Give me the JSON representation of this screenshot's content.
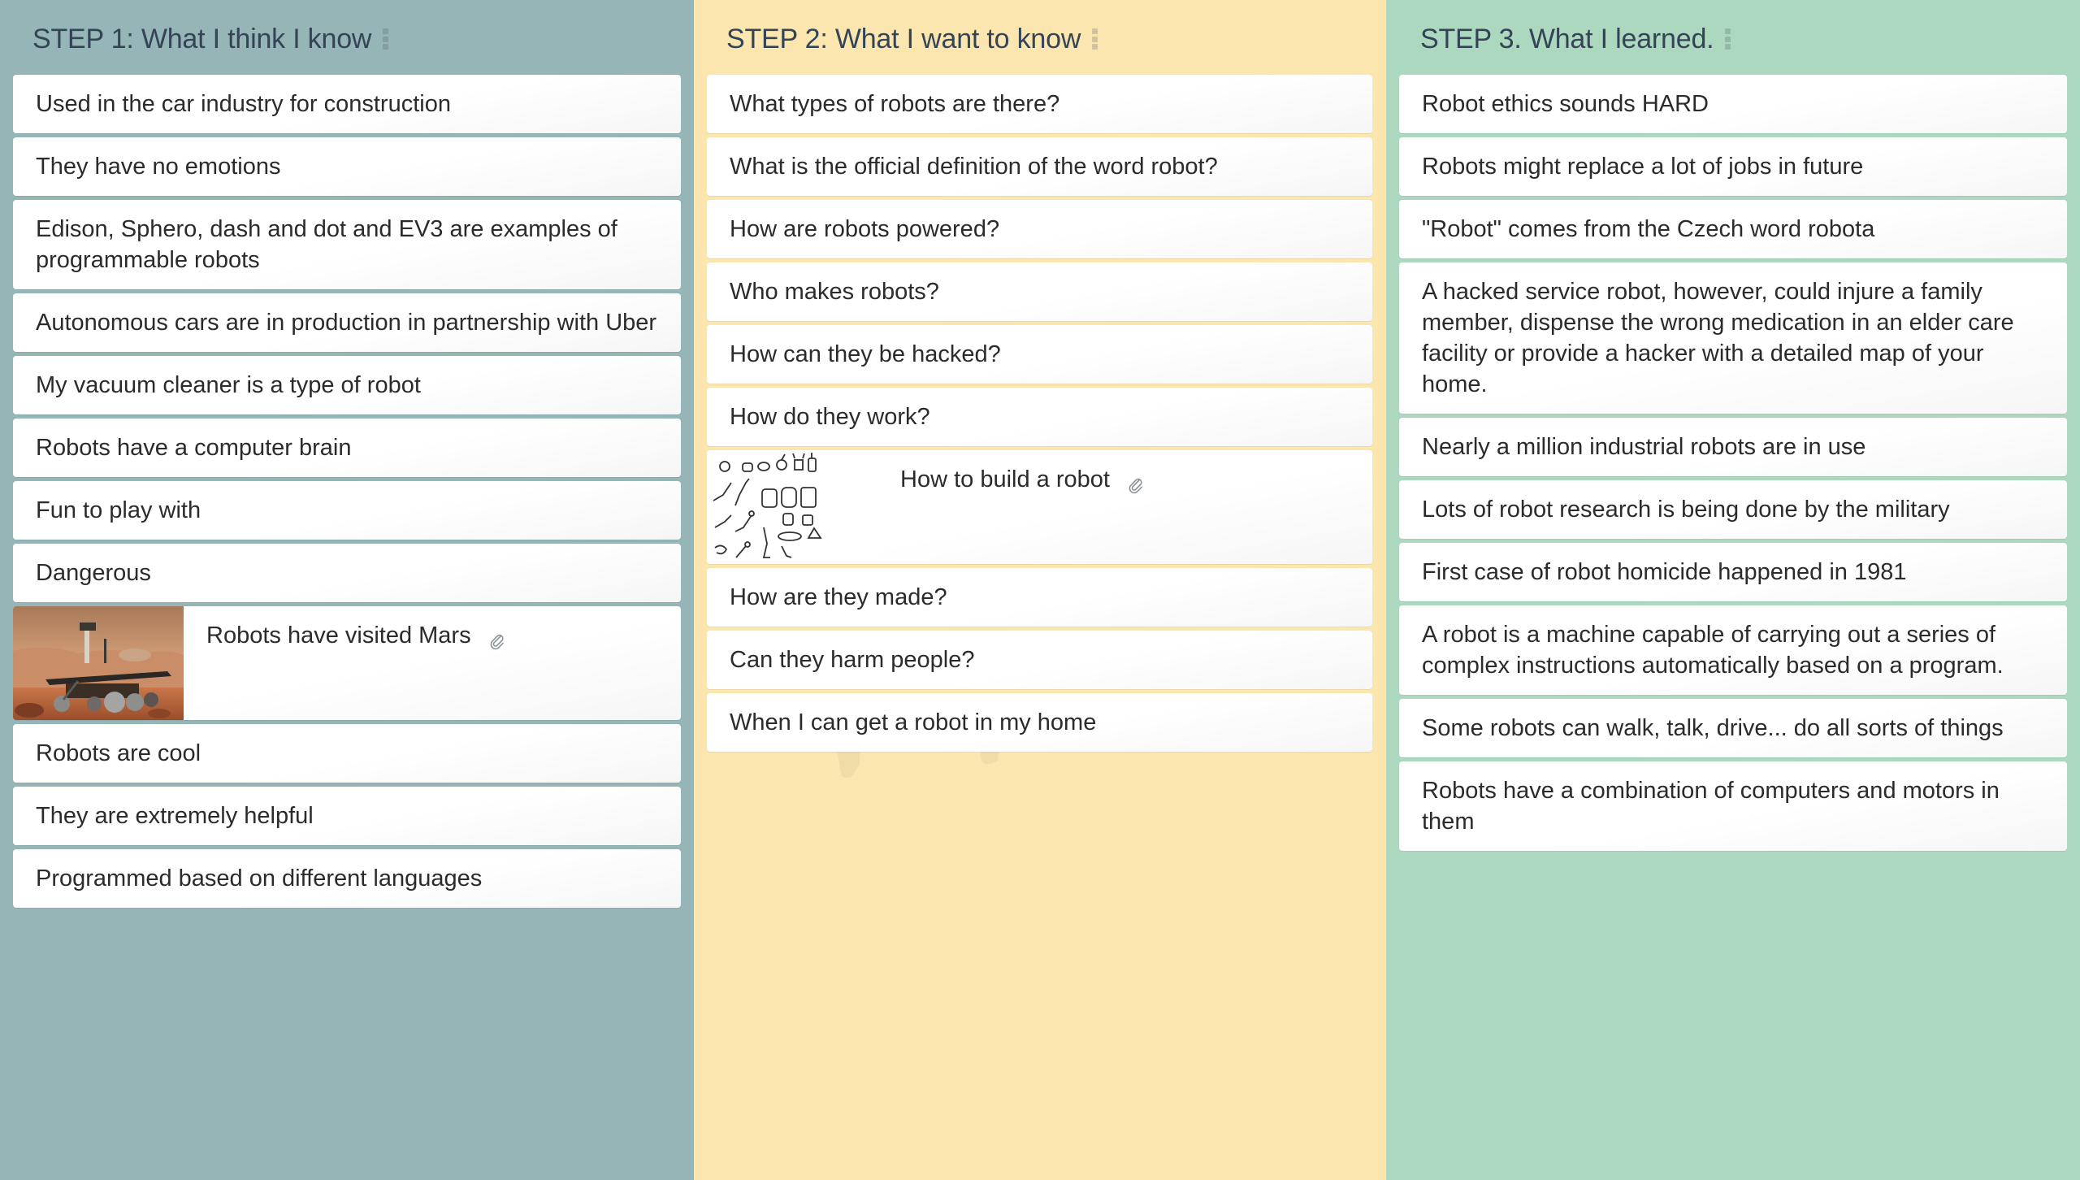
{
  "board": {
    "columns": [
      {
        "title": "STEP 1: What I think I know",
        "color": "#96b5b6",
        "cards": [
          {
            "text": "Used in the car industry for construction"
          },
          {
            "text": "They have no emotions"
          },
          {
            "text": "Edison, Sphero, dash and dot and EV3 are examples of programmable robots"
          },
          {
            "text": "Autonomous cars are in production in partnership with Uber"
          },
          {
            "text": "My vacuum cleaner is a type of robot"
          },
          {
            "text": "Robots have a computer brain"
          },
          {
            "text": "Fun to play with"
          },
          {
            "text": "Dangerous"
          },
          {
            "text": "Robots have visited Mars",
            "image": "mars-rover-photo",
            "attachment": true
          },
          {
            "text": "Robots are cool"
          },
          {
            "text": "They are extremely helpful"
          },
          {
            "text": "Programmed based on different languages"
          }
        ]
      },
      {
        "title": "STEP 2: What I want to know",
        "color": "#fbe6b0",
        "cards": [
          {
            "text": "What types of robots are there?"
          },
          {
            "text": "What is the official definition of the word robot?"
          },
          {
            "text": "How are robots powered?"
          },
          {
            "text": "Who makes robots?"
          },
          {
            "text": "How can they be hacked?"
          },
          {
            "text": "How do they work?"
          },
          {
            "text": "How to build a robot",
            "image": "robot-sketches",
            "attachment": true
          },
          {
            "text": "How are they made?"
          },
          {
            "text": "Can they harm people?"
          },
          {
            "text": "When I can get a robot in my home"
          }
        ]
      },
      {
        "title": "STEP 3. What I learned.",
        "color": "#acd8bf",
        "cards": [
          {
            "text": "Robot ethics sounds HARD"
          },
          {
            "text": "Robots might replace a lot of jobs in future"
          },
          {
            "text": "\"Robot\" comes from the Czech word robota"
          },
          {
            "text": "A hacked service robot, however, could injure a family member, dispense the wrong medication in an elder care facility or provide a hacker with a detailed map of your home."
          },
          {
            "text": "Nearly a million industrial robots are in use"
          },
          {
            "text": "Lots of robot research is being done by the military"
          },
          {
            "text": "First case of robot homicide happened in 1981"
          },
          {
            "text": "A robot is a  machine capable of carrying out a series of complex instructions automatically based on a program."
          },
          {
            "text": "Some robots can walk, talk, drive... do all sorts of things"
          },
          {
            "text": "Robots have a combination of computers and motors in them"
          }
        ]
      }
    ]
  },
  "icons": {
    "column_menu": "vertical-dots-icon",
    "attachment": "paperclip-icon"
  }
}
